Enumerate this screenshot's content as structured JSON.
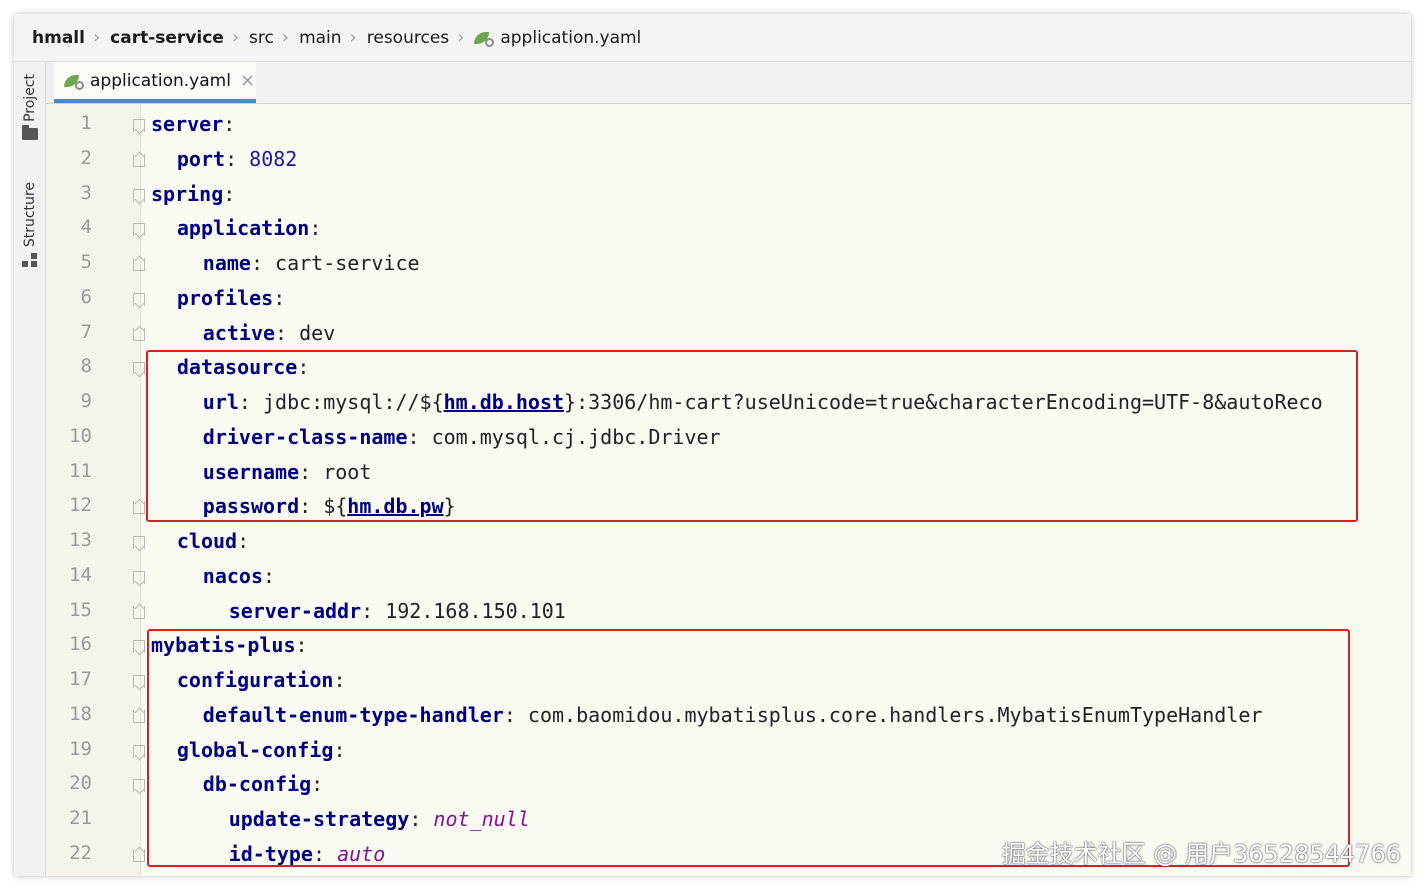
{
  "breadcrumb": [
    {
      "label": "hmall",
      "bold": true
    },
    {
      "label": "cart-service",
      "bold": true
    },
    {
      "label": "src",
      "bold": false
    },
    {
      "label": "main",
      "bold": false
    },
    {
      "label": "resources",
      "bold": false
    },
    {
      "label": "application.yaml",
      "bold": false,
      "icon": "yaml-file-icon"
    }
  ],
  "tool_windows": {
    "project_label": "Project",
    "structure_label": "Structure"
  },
  "editor_tab": {
    "label": "application.yaml",
    "close_glyph": "×",
    "icon": "yaml-file-icon",
    "accent": "#4a88c7"
  },
  "code_lines": [
    {
      "n": "1",
      "indent": 0,
      "fold": "open",
      "tokens": [
        {
          "t": "server",
          "c": "k"
        },
        {
          "t": ":",
          "c": "v"
        }
      ]
    },
    {
      "n": "2",
      "indent": 1,
      "fold": "close",
      "tokens": [
        {
          "t": "port",
          "c": "k"
        },
        {
          "t": ": ",
          "c": "v"
        },
        {
          "t": "8082",
          "c": "num"
        }
      ]
    },
    {
      "n": "3",
      "indent": 0,
      "fold": "open",
      "tokens": [
        {
          "t": "spring",
          "c": "k"
        },
        {
          "t": ":",
          "c": "v"
        }
      ]
    },
    {
      "n": "4",
      "indent": 1,
      "fold": "open",
      "tokens": [
        {
          "t": "application",
          "c": "k"
        },
        {
          "t": ":",
          "c": "v"
        }
      ]
    },
    {
      "n": "5",
      "indent": 2,
      "fold": "close",
      "tokens": [
        {
          "t": "name",
          "c": "k"
        },
        {
          "t": ": cart-service",
          "c": "v"
        }
      ]
    },
    {
      "n": "6",
      "indent": 1,
      "fold": "open",
      "tokens": [
        {
          "t": "profiles",
          "c": "k"
        },
        {
          "t": ":",
          "c": "v"
        }
      ]
    },
    {
      "n": "7",
      "indent": 2,
      "fold": "close",
      "tokens": [
        {
          "t": "active",
          "c": "k"
        },
        {
          "t": ": dev",
          "c": "v"
        }
      ]
    },
    {
      "n": "8",
      "indent": 1,
      "fold": "open",
      "tokens": [
        {
          "t": "datasource",
          "c": "k"
        },
        {
          "t": ":",
          "c": "v"
        }
      ]
    },
    {
      "n": "9",
      "indent": 2,
      "fold": "",
      "tokens": [
        {
          "t": "url",
          "c": "k"
        },
        {
          "t": ": jdbc:mysql://${",
          "c": "v"
        },
        {
          "t": "hm.db.host",
          "c": "ref"
        },
        {
          "t": "}:3306/hm-cart?useUnicode=true&characterEncoding=UTF-8&autoReco",
          "c": "v"
        }
      ]
    },
    {
      "n": "10",
      "indent": 2,
      "fold": "",
      "tokens": [
        {
          "t": "driver-class-name",
          "c": "k"
        },
        {
          "t": ": com.mysql.cj.jdbc.Driver",
          "c": "v"
        }
      ]
    },
    {
      "n": "11",
      "indent": 2,
      "fold": "",
      "tokens": [
        {
          "t": "username",
          "c": "k"
        },
        {
          "t": ": root",
          "c": "v"
        }
      ]
    },
    {
      "n": "12",
      "indent": 2,
      "fold": "close",
      "tokens": [
        {
          "t": "password",
          "c": "k"
        },
        {
          "t": ": ${",
          "c": "v"
        },
        {
          "t": "hm.db.pw",
          "c": "ref"
        },
        {
          "t": "}",
          "c": "v"
        }
      ]
    },
    {
      "n": "13",
      "indent": 1,
      "fold": "open",
      "tokens": [
        {
          "t": "cloud",
          "c": "k"
        },
        {
          "t": ":",
          "c": "v"
        }
      ]
    },
    {
      "n": "14",
      "indent": 2,
      "fold": "open",
      "tokens": [
        {
          "t": "nacos",
          "c": "k"
        },
        {
          "t": ":",
          "c": "v"
        }
      ]
    },
    {
      "n": "15",
      "indent": 3,
      "fold": "close",
      "tokens": [
        {
          "t": "server-addr",
          "c": "k"
        },
        {
          "t": ": 192.168.150.101",
          "c": "v"
        }
      ]
    },
    {
      "n": "16",
      "indent": 0,
      "fold": "open",
      "tokens": [
        {
          "t": "mybatis-plus",
          "c": "k"
        },
        {
          "t": ":",
          "c": "v"
        }
      ]
    },
    {
      "n": "17",
      "indent": 1,
      "fold": "open",
      "tokens": [
        {
          "t": "configuration",
          "c": "k"
        },
        {
          "t": ":",
          "c": "v"
        }
      ]
    },
    {
      "n": "18",
      "indent": 2,
      "fold": "close",
      "tokens": [
        {
          "t": "default-enum-type-handler",
          "c": "k"
        },
        {
          "t": ": com.baomidou.mybatisplus.core.handlers.MybatisEnumTypeHandler",
          "c": "v"
        }
      ]
    },
    {
      "n": "19",
      "indent": 1,
      "fold": "open",
      "tokens": [
        {
          "t": "global-config",
          "c": "k"
        },
        {
          "t": ":",
          "c": "v"
        }
      ]
    },
    {
      "n": "20",
      "indent": 2,
      "fold": "open",
      "tokens": [
        {
          "t": "db-config",
          "c": "k"
        },
        {
          "t": ":",
          "c": "v"
        }
      ]
    },
    {
      "n": "21",
      "indent": 3,
      "fold": "",
      "tokens": [
        {
          "t": "update-strategy",
          "c": "k"
        },
        {
          "t": ": ",
          "c": "v"
        },
        {
          "t": "not_null",
          "c": "it"
        }
      ]
    },
    {
      "n": "22",
      "indent": 3,
      "fold": "close",
      "tokens": [
        {
          "t": "id-type",
          "c": "k"
        },
        {
          "t": ": ",
          "c": "v"
        },
        {
          "t": "auto",
          "c": "it"
        }
      ]
    }
  ],
  "highlight_color": "#d61f26",
  "watermark": "掘金技术社区 @ 用户36528544766"
}
